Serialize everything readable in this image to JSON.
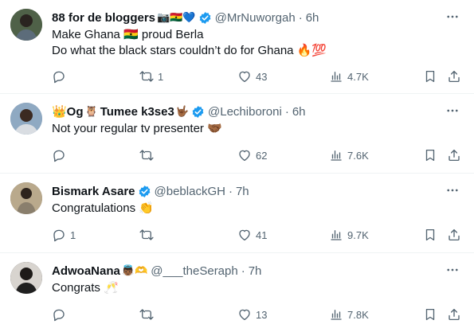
{
  "tweets": [
    {
      "name": "88 for de bloggers",
      "name_emoji": "📷🇬🇭💙",
      "handle": "@MrNuworgah",
      "time": "6h",
      "lines": [
        "Make Ghana 🇬🇭 proud Berla",
        "Do what the black stars couldn’t do for Ghana 🔥💯"
      ],
      "counts": {
        "reply": "",
        "retweet": "1",
        "like": "43",
        "views": "4.7K"
      },
      "avatar_color": "#3b4a3a"
    },
    {
      "name_prefix": "👑Og",
      "name_mid": "🦉",
      "name": "Tumee k3se3",
      "name_emoji": "🤟🏾",
      "handle": "@Lechiboroni",
      "time": "6h",
      "lines": [
        "Not your regular tv presenter 🤝🏾"
      ],
      "counts": {
        "reply": "",
        "retweet": "",
        "like": "62",
        "views": "7.6K"
      },
      "avatar_color": "#6d8aa6"
    },
    {
      "name": "Bismark Asare",
      "name_emoji": "",
      "handle": "@beblackGH",
      "time": "7h",
      "lines": [
        "Congratulations 👏"
      ],
      "counts": {
        "reply": "1",
        "retweet": "",
        "like": "41",
        "views": "9.7K"
      },
      "avatar_color": "#7a6a55"
    },
    {
      "name": "AdwoaNana",
      "name_emoji": "👼🏾🫶",
      "handle": "@___theSeraph",
      "time": "7h",
      "lines": [
        "Congrats 🥂"
      ],
      "counts": {
        "reply": "",
        "retweet": "",
        "like": "13",
        "views": "7.8K"
      },
      "avatar_color": "#2b2b2b"
    }
  ],
  "colors": {
    "text": "#0f1419",
    "muted": "#536471",
    "verified": "#1d9bf0",
    "divider": "#eff3f4"
  },
  "icons": [
    "reply-icon",
    "retweet-icon",
    "like-icon",
    "views-icon",
    "bookmark-icon",
    "share-icon",
    "more-icon",
    "verified-badge-icon"
  ]
}
